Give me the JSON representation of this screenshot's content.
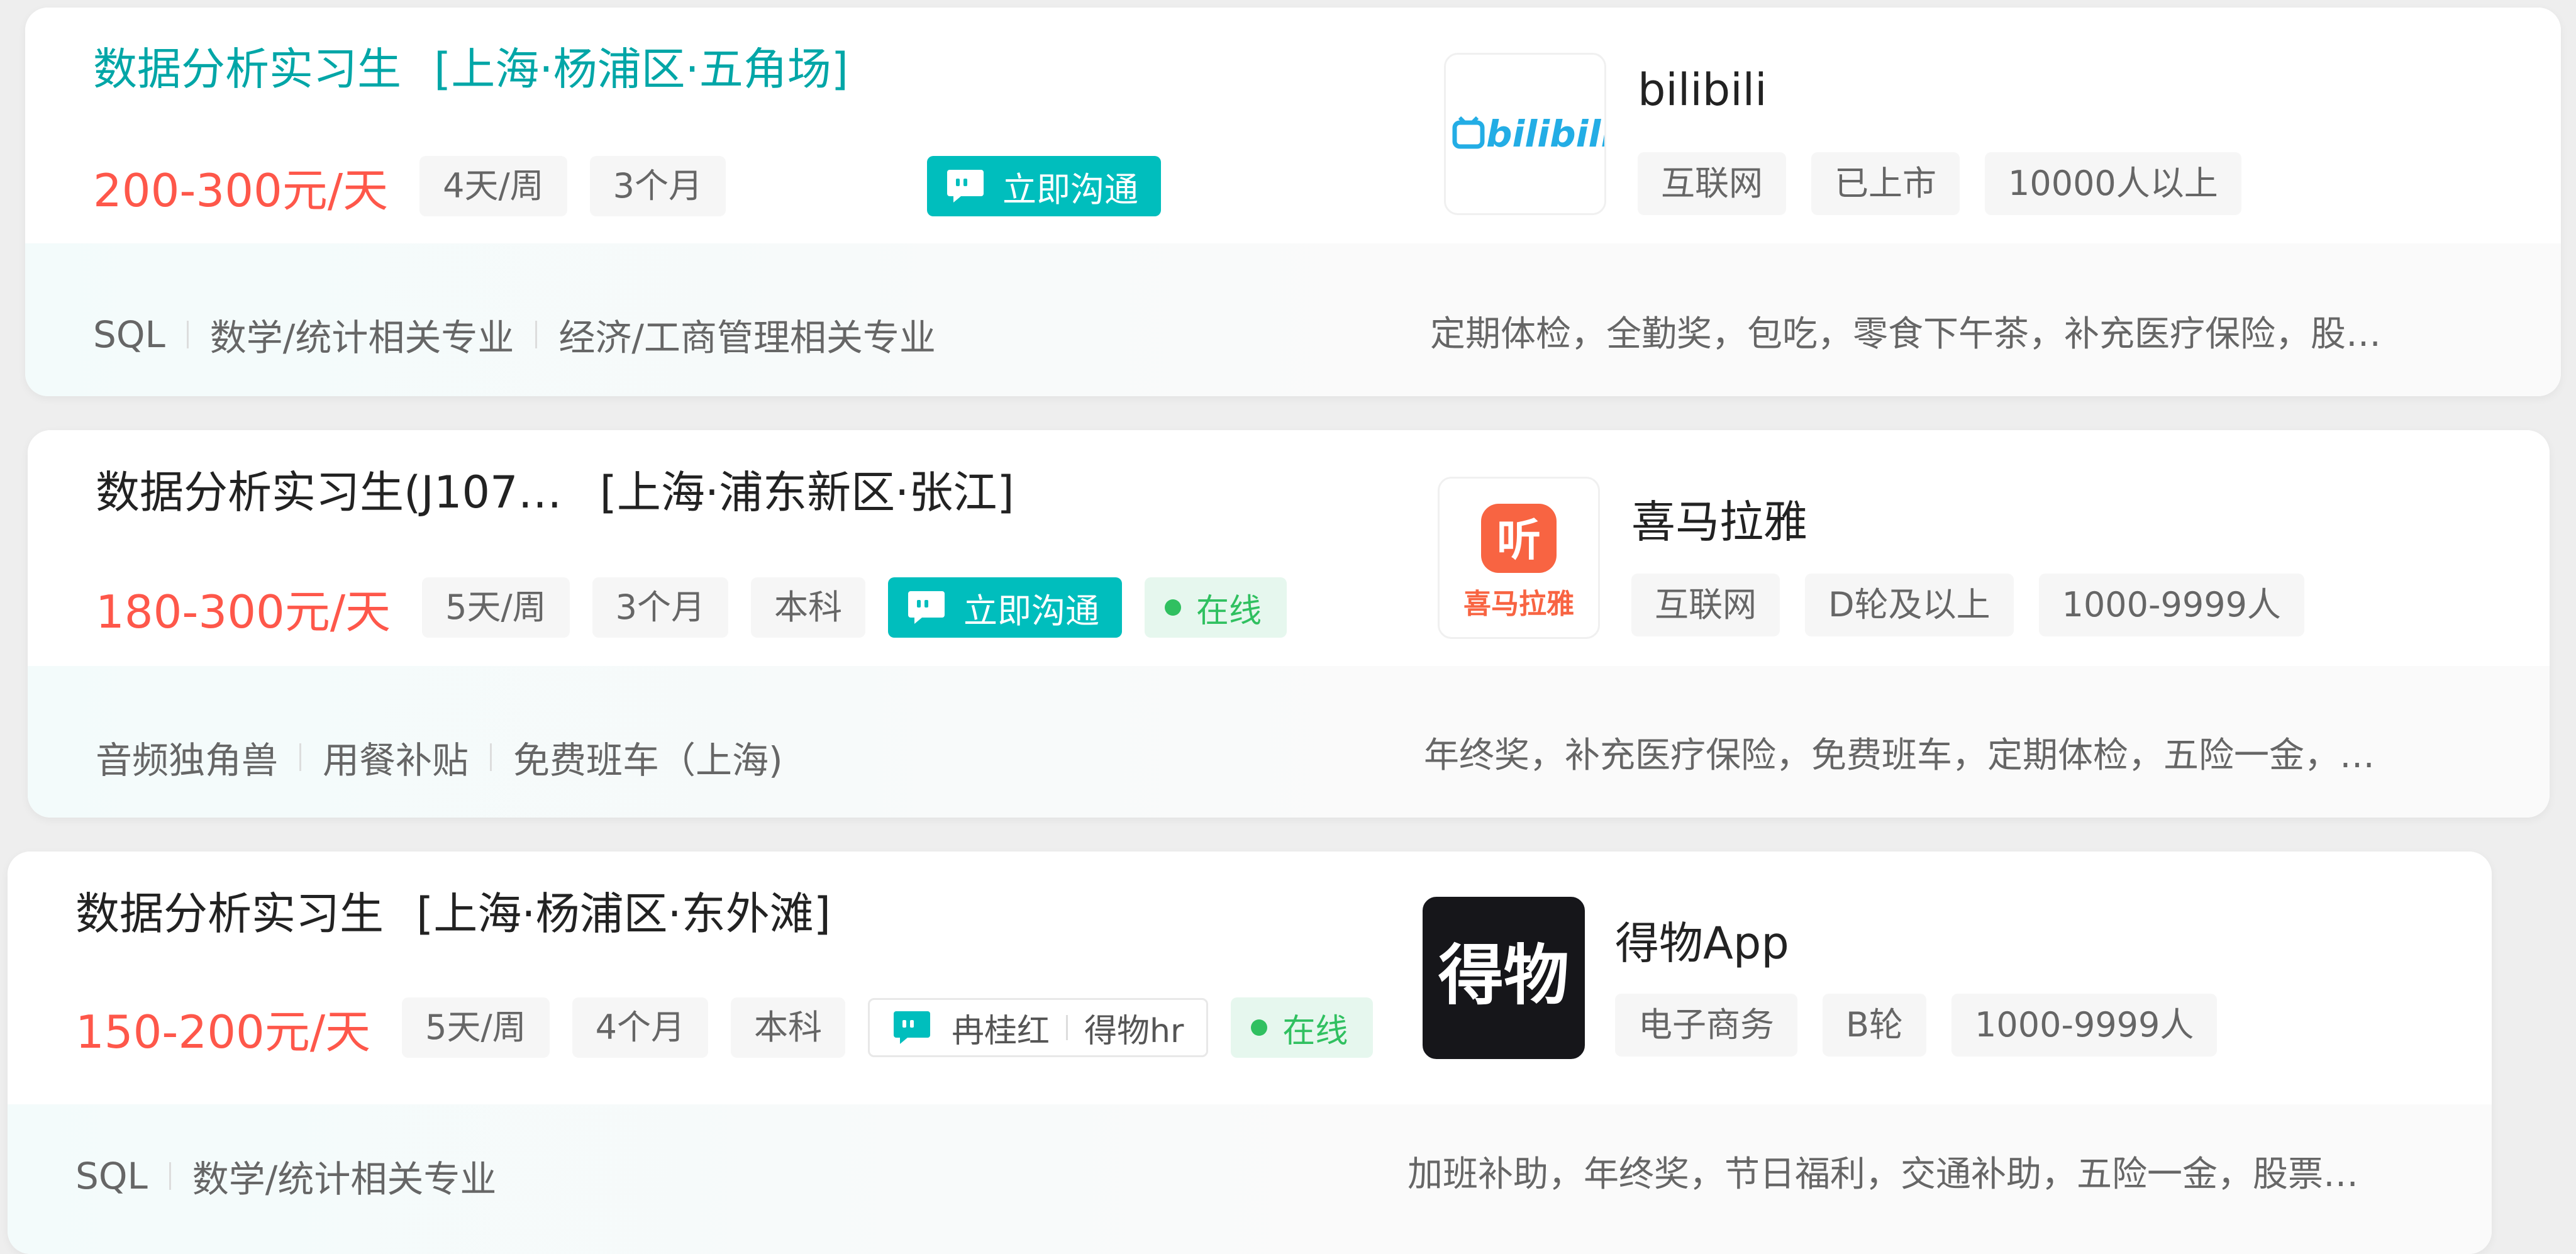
{
  "jobs": [
    {
      "title": "数据分析实习生",
      "location": "[上海·杨浦区·五角场]",
      "salary": "200-300元/天",
      "tags": [
        "4天/周",
        "3个月"
      ],
      "chat_label": "立即沟通",
      "company": "bilibili",
      "company_tags": [
        "互联网",
        "已上市",
        "10000人以上"
      ],
      "skills": [
        "SQL",
        "数学/统计相关专业",
        "经济/工商管理相关专业"
      ],
      "benefits": "定期体检，全勤奖，包吃，零食下午茶，补充医疗保险，股…",
      "logo_text": "bilibili"
    },
    {
      "title": "数据分析实习生(J107…",
      "location": "[上海·浦东新区·张江]",
      "salary": "180-300元/天",
      "tags": [
        "5天/周",
        "3个月",
        "本科"
      ],
      "chat_label": "立即沟通",
      "online_label": "在线",
      "company": "喜马拉雅",
      "company_tags": [
        "互联网",
        "D轮及以上",
        "1000-9999人"
      ],
      "skills": [
        "音频独角兽",
        "用餐补贴",
        "免费班车（上海)"
      ],
      "benefits": "年终奖，补充医疗保险，免费班车，定期体检，五险一金，…",
      "logo_text_top": "听",
      "logo_text_bottom": "喜马拉雅"
    },
    {
      "title": "数据分析实习生",
      "location": "[上海·杨浦区·东外滩]",
      "salary": "150-200元/天",
      "tags": [
        "5天/周",
        "4个月",
        "本科"
      ],
      "recruiter_name": "冉桂红",
      "recruiter_title": "得物hr",
      "online_label": "在线",
      "company": "得物App",
      "company_tags": [
        "电子商务",
        "B轮",
        "1000-9999人"
      ],
      "skills": [
        "SQL",
        "数学/统计相关专业"
      ],
      "benefits": "加班补助，年终奖，节日福利，交通补助，五险一金，股票…",
      "logo_text": "得物"
    }
  ],
  "colors": {
    "accent": "#00bebd",
    "salary": "#fe574a",
    "title_hover": "#00a6a7",
    "online": "#30c060"
  }
}
